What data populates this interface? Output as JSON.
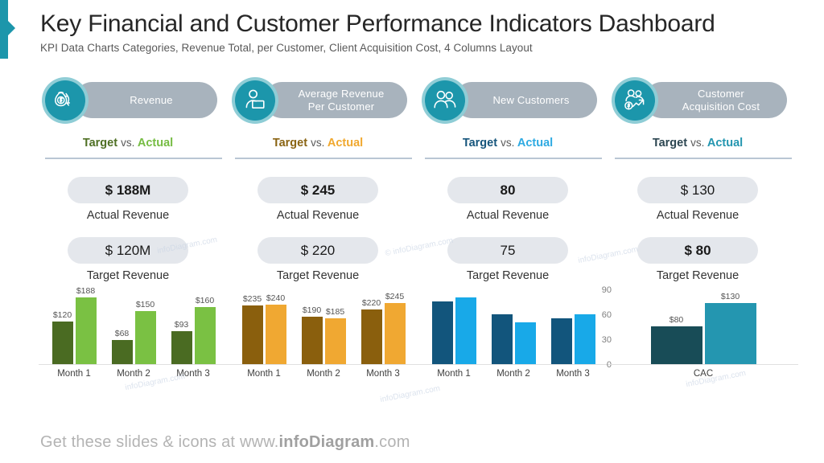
{
  "header": {
    "title": "Key Financial and Customer Performance Indicators Dashboard",
    "subtitle": "KPI Data Charts Categories, Revenue Total, per Customer, Client Acquisition Cost, 4 Columns Layout"
  },
  "footer": {
    "prefix": "Get these slides & icons at www.",
    "brand": "infoDiagram",
    "suffix": ".com"
  },
  "labels": {
    "target_word": "Target",
    "vs_word": "vs.",
    "actual_word": "Actual",
    "actual_caption": "Actual Revenue",
    "target_caption": "Target Revenue"
  },
  "watermarks": [
    "infoDiagram.com",
    "© infoDiagram.com",
    "infoDiagram.com",
    "infoDiagram.com",
    "infoDiagram.com",
    "infoDiagram.com"
  ],
  "theme": {
    "accent": "#1c96ab",
    "icon_circle": "#1c96ab",
    "icon_ring": "#8fcdd6",
    "pill": "#a8b3bd",
    "capsule": "#e4e7ec",
    "divider": "#b9c6d4",
    "title_color": "#262626"
  },
  "columns": [
    {
      "id": "revenue",
      "icon": "money-bag-cycle-icon",
      "pill_label_line1": "Revenue",
      "pill_label_line2": "",
      "target_color": "#4f7024",
      "actual_color": "#76bc43",
      "actual_value": "$ 188M",
      "actual_bold": true,
      "target_value": "$ 120M",
      "target_bold": false
    },
    {
      "id": "avg-revenue-per-customer",
      "icon": "person-card-icon",
      "pill_label_line1": "Average  Revenue",
      "pill_label_line2": "Per Customer",
      "target_color": "#8a6413",
      "actual_color": "#f0a82e",
      "actual_value": "$ 245",
      "actual_bold": true,
      "target_value": "$ 220",
      "target_bold": false
    },
    {
      "id": "new-customers",
      "icon": "two-people-icon",
      "pill_label_line1": "New Customers",
      "pill_label_line2": "",
      "target_color": "#16557c",
      "actual_color": "#2eaae2",
      "actual_value": "80",
      "actual_bold": true,
      "target_value": "75",
      "target_bold": false
    },
    {
      "id": "customer-acquisition-cost",
      "icon": "people-dollar-growth-icon",
      "pill_label_line1": "Customer",
      "pill_label_line2": "Acquisition Cost",
      "target_color": "#2c4651",
      "actual_color": "#2496b0",
      "actual_value": "$ 130",
      "actual_bold": false,
      "target_value": "$ 80",
      "target_bold": true
    }
  ],
  "chart_data": [
    {
      "type": "bar",
      "id": "revenue-chart",
      "categories": [
        "Month 1",
        "Month 2",
        "Month 3"
      ],
      "series": [
        {
          "name": "Target",
          "color": "#4a6b22",
          "values": [
            120,
            68,
            93
          ],
          "labels": [
            "$120",
            "$68",
            "$93"
          ]
        },
        {
          "name": "Actual",
          "color": "#7ac143",
          "values": [
            188,
            150,
            160
          ],
          "labels": [
            "$188",
            "$150",
            "$160"
          ]
        }
      ],
      "ylim": [
        0,
        210
      ],
      "show_labels": true,
      "axis": "none",
      "grid": false,
      "title": "",
      "xlabel": "",
      "ylabel": ""
    },
    {
      "type": "bar",
      "id": "avg-revenue-chart",
      "categories": [
        "Month 1",
        "Month 2",
        "Month 3"
      ],
      "series": [
        {
          "name": "Target",
          "color": "#8a5f0d",
          "values": [
            235,
            190,
            220
          ],
          "labels": [
            "$235",
            "$190",
            "$220"
          ]
        },
        {
          "name": "Actual",
          "color": "#f0a832",
          "values": [
            240,
            185,
            245
          ],
          "labels": [
            "$240",
            "$185",
            "$245"
          ]
        }
      ],
      "ylim": [
        0,
        300
      ],
      "show_labels": true,
      "axis": "none",
      "grid": false,
      "title": "",
      "xlabel": "",
      "ylabel": ""
    },
    {
      "type": "bar",
      "id": "new-customers-chart",
      "categories": [
        "Month 1",
        "Month 2",
        "Month 3"
      ],
      "series": [
        {
          "name": "Target",
          "color": "#12557c",
          "values": [
            75,
            60,
            55
          ],
          "labels": [
            "",
            "",
            ""
          ]
        },
        {
          "name": "Actual",
          "color": "#18a9e8",
          "values": [
            80,
            50,
            60
          ],
          "labels": [
            "",
            "",
            ""
          ]
        }
      ],
      "ylim": [
        0,
        90
      ],
      "yticks": [
        90,
        60,
        30,
        0
      ],
      "show_labels": false,
      "axis": "right",
      "grid": false,
      "title": "",
      "xlabel": "",
      "ylabel": ""
    },
    {
      "type": "bar",
      "id": "cac-chart",
      "categories": [
        "CAC"
      ],
      "series": [
        {
          "name": "Target",
          "color": "#184c57",
          "values": [
            80
          ],
          "labels": [
            "$80"
          ]
        },
        {
          "name": "Actual",
          "color": "#2496b0",
          "values": [
            130
          ],
          "labels": [
            "$130"
          ]
        }
      ],
      "ylim": [
        0,
        160
      ],
      "show_labels": true,
      "axis": "none",
      "grid": false,
      "title": "",
      "xlabel": "",
      "ylabel": ""
    }
  ]
}
